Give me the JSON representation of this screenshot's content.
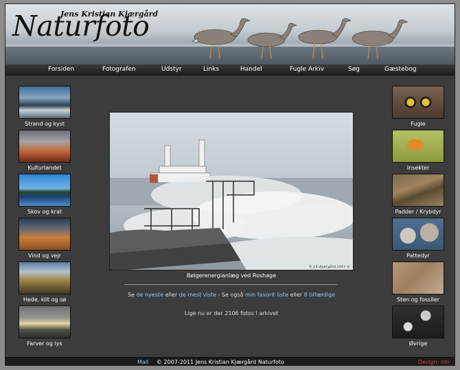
{
  "header": {
    "subtitle": "Jens Kristian Kjærgård",
    "title": "Naturfoto"
  },
  "nav": [
    {
      "label": "Forsiden"
    },
    {
      "label": "Fotografen"
    },
    {
      "label": "Udstyr"
    },
    {
      "label": "Links"
    },
    {
      "label": "Handel"
    },
    {
      "label": "Fugle Arkiv"
    },
    {
      "label": "Søg"
    },
    {
      "label": "Gæstebog"
    }
  ],
  "left_categories": [
    {
      "label": "Strand og kyst"
    },
    {
      "label": "Kulturlandet"
    },
    {
      "label": "Skov og krat"
    },
    {
      "label": "Vind og vejr"
    },
    {
      "label": "Hede, klit og sø"
    },
    {
      "label": "Farver og lys"
    }
  ],
  "right_categories": [
    {
      "label": "Fugle"
    },
    {
      "label": "Insekter"
    },
    {
      "label": "Padder / Krybdyr"
    },
    {
      "label": "Pattedyr"
    },
    {
      "label": "Sten og fossiler"
    },
    {
      "label": "Øvrige"
    }
  ],
  "main": {
    "photo_caption": "Bølgerenergianlæg ved Roshage",
    "photo_signature": "© J.K.Kjærgård 2011 ©",
    "links_line": {
      "se": "Se",
      "newest": "de nyeste",
      "or1": "eller",
      "most_viewed": "de mest viste",
      "see_also": "- Se også",
      "favorites": "min favorit liste",
      "or2": "eller",
      "random": "8 tilfældige"
    },
    "count_text": "Lige nu er der 2106 fotos i arkivet"
  },
  "footer": {
    "mail": "Mail",
    "copyright": "© 2007-2011 Jens Kristian Kjærgård Naturfoto",
    "design": "Design: hfn"
  }
}
